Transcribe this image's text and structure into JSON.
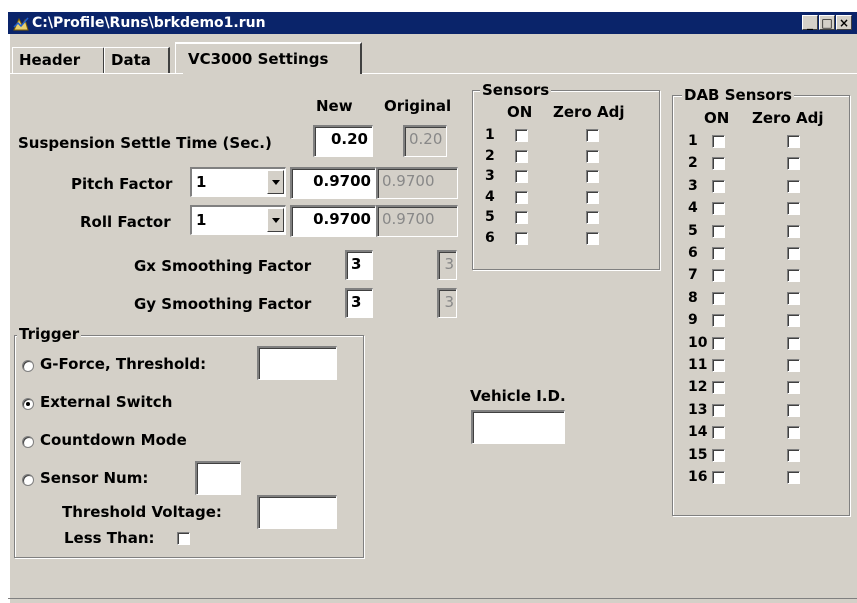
{
  "window": {
    "title": "C:\\Profile\\Runs\\brkdemo1.run",
    "minimize": "_",
    "maximize": "□",
    "close": "×"
  },
  "tabs": [
    {
      "label": "Header"
    },
    {
      "label": "Data"
    },
    {
      "label": "VC3000 Settings"
    }
  ],
  "settings": {
    "col_new": "New",
    "col_original": "Original",
    "suspension": {
      "label": "Suspension Settle Time (Sec.)",
      "new": "0.20",
      "original": "0.20"
    },
    "pitch": {
      "label": "Pitch Factor",
      "select": "1",
      "new": "0.9700",
      "original": "0.9700"
    },
    "roll": {
      "label": "Roll Factor",
      "select": "1",
      "new": "0.9700",
      "original": "0.9700"
    },
    "gx": {
      "label": "Gx Smoothing Factor",
      "new": "3",
      "original": "3"
    },
    "gy": {
      "label": "Gy Smoothing Factor",
      "new": "3",
      "original": "3"
    }
  },
  "trigger": {
    "title": "Trigger",
    "gforce_label": "G-Force, Threshold:",
    "gforce_value": "",
    "external_label": "External Switch",
    "countdown_label": "Countdown Mode",
    "sensor_num_label": "Sensor Num:",
    "sensor_num_value": "",
    "threshold_voltage_label": "Threshold Voltage:",
    "threshold_voltage_value": "",
    "less_than_label": "Less Than:",
    "selected": "external_switch"
  },
  "sensors": {
    "title": "Sensors",
    "col_on": "ON",
    "col_zero": "Zero Adj",
    "rows": [
      "1",
      "2",
      "3",
      "4",
      "5",
      "6"
    ]
  },
  "vehicle": {
    "label": "Vehicle I.D.",
    "value": ""
  },
  "dab": {
    "title": "DAB Sensors",
    "col_on": "ON",
    "col_zero": "Zero Adj",
    "rows": [
      "1",
      "2",
      "3",
      "4",
      "5",
      "6",
      "7",
      "8",
      "9",
      "10",
      "11",
      "12",
      "13",
      "14",
      "15",
      "16"
    ]
  }
}
